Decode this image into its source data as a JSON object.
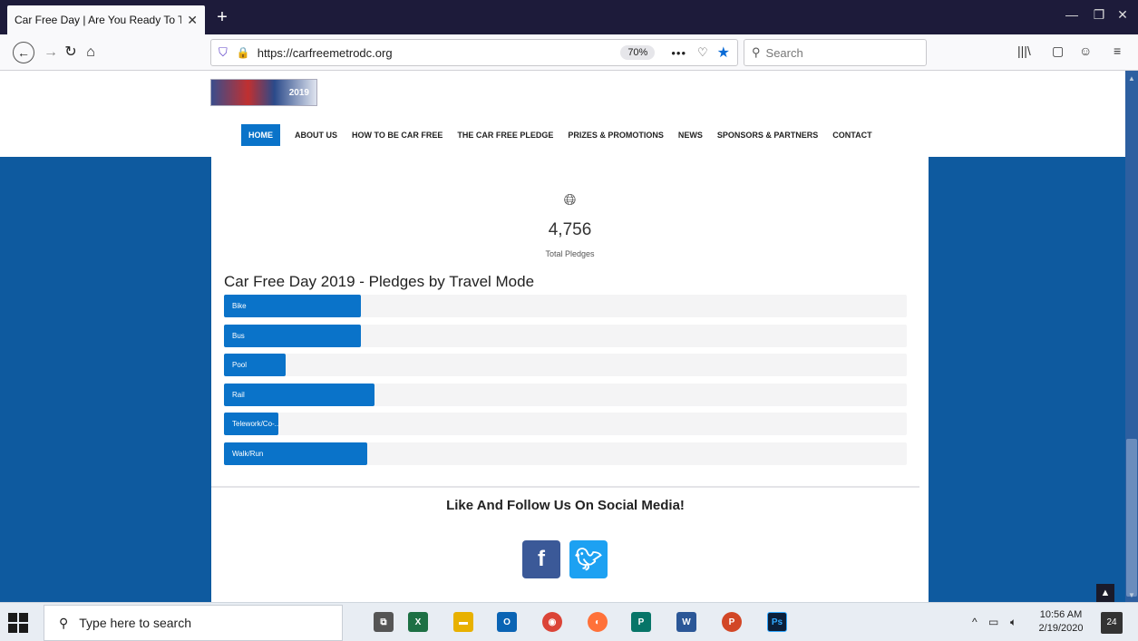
{
  "browser": {
    "tab_title": "Car Free Day | Are You Ready To Tal",
    "url": "https://carfreemetrodc.org",
    "zoom": "70%",
    "search_placeholder": "Search"
  },
  "site": {
    "logo_text": "2019",
    "nav": [
      "HOME",
      "ABOUT US",
      "HOW TO BE CAR FREE",
      "THE CAR FREE PLEDGE",
      "PRIZES & PROMOTIONS",
      "NEWS",
      "SPONSORS & PARTNERS",
      "CONTACT"
    ],
    "active_nav": "HOME",
    "total_pledges": "4,756",
    "total_label": "Total Pledges",
    "social_heading": "Like And Follow Us On Social Media!"
  },
  "chart_data": {
    "type": "bar",
    "title": "Car Free Day 2019 - Pledges by Travel Mode",
    "categories": [
      "Bike",
      "Bus",
      "Pool",
      "Rail",
      "Telework/Co-...",
      "Walk/Run"
    ],
    "values": [
      0.2,
      0.2,
      0.09,
      0.22,
      0.08,
      0.21
    ],
    "value_unit": "fraction of bar track filled",
    "bar_color": "#0a73c9"
  },
  "taskbar": {
    "search_placeholder": "Type here to search",
    "time": "10:56 AM",
    "date": "2/19/2020",
    "notifications": "24"
  }
}
